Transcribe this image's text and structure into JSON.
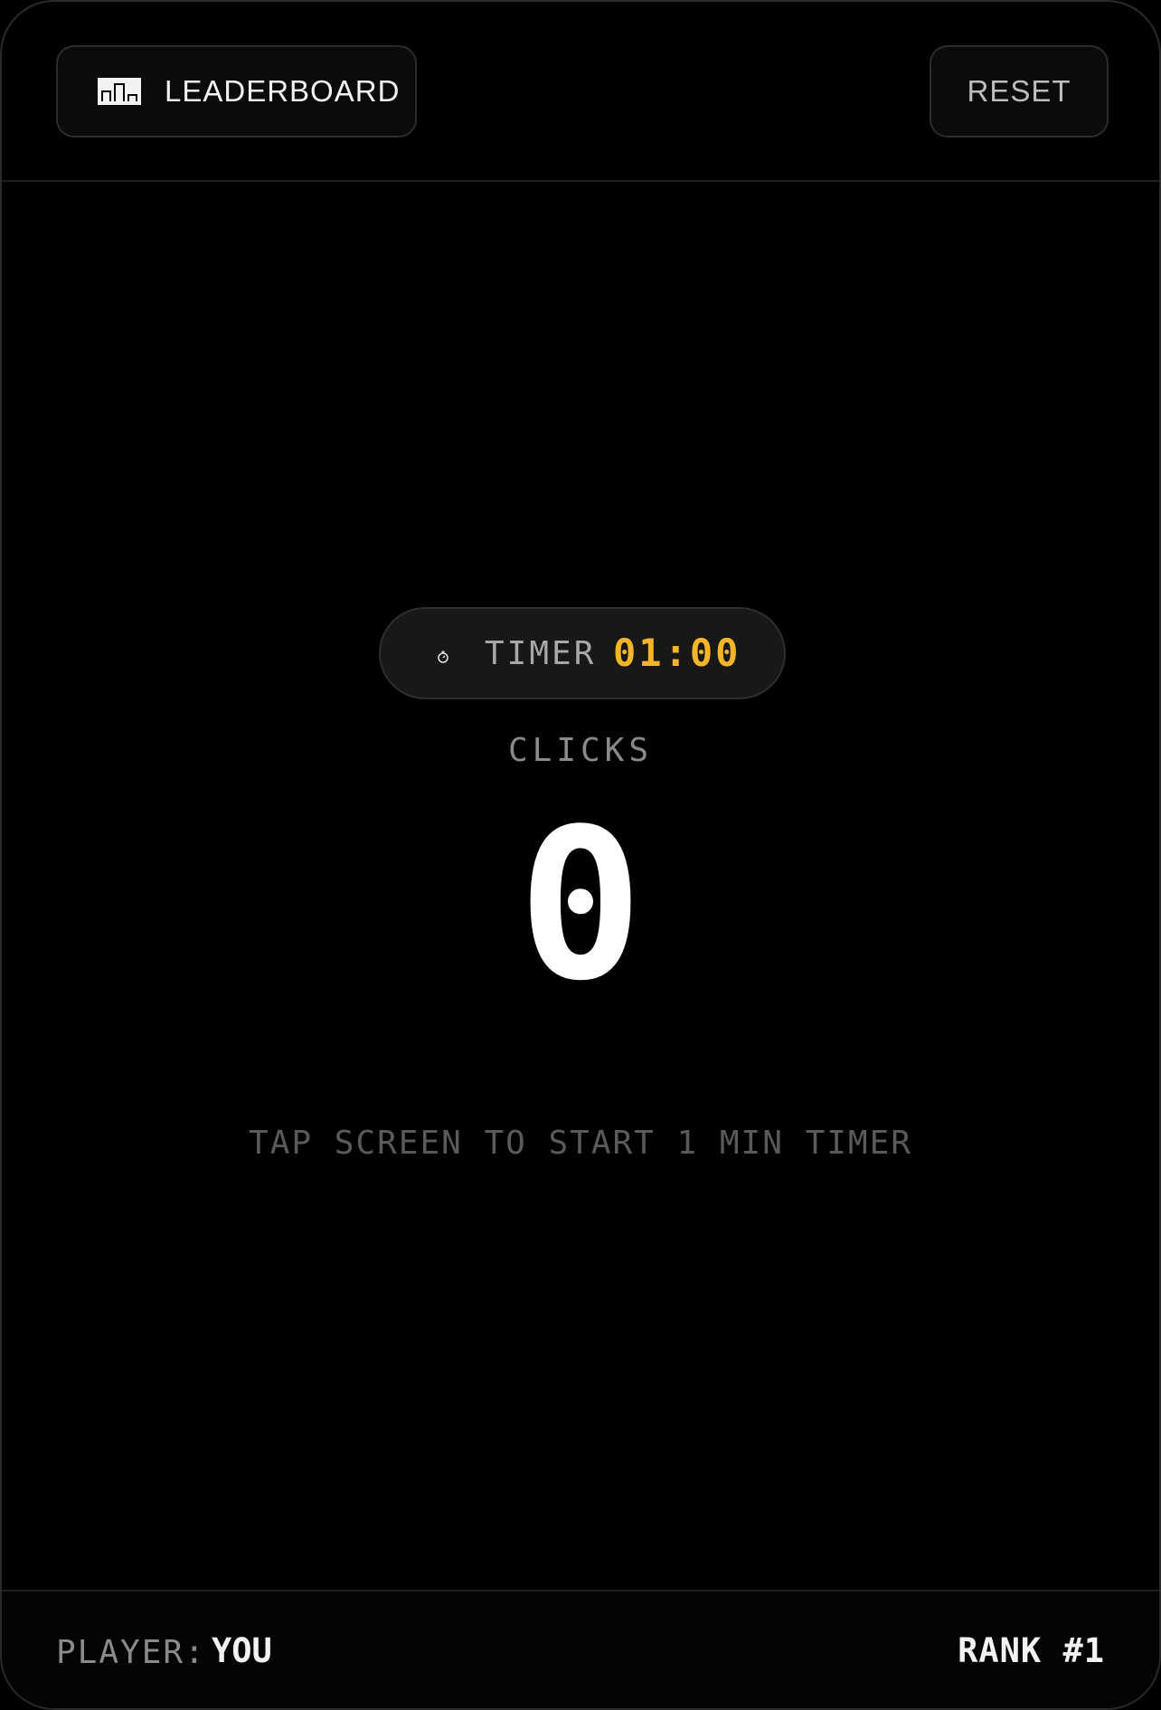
{
  "header": {
    "leaderboard_label": "LEADERBOARD",
    "leaderboard_icon": "podium-icon",
    "reset_label": "RESET"
  },
  "timer": {
    "icon": "stopwatch-icon",
    "label": "TIMER",
    "value": "01:00"
  },
  "counter": {
    "label": "CLICKS",
    "value": "0"
  },
  "hint": "TAP SCREEN TO START 1 MIN TIMER",
  "footer": {
    "player_label": "PLAYER:",
    "player_name": "YOU",
    "rank": "RANK #1"
  },
  "colors": {
    "background": "#000000",
    "accent": "#f5b52a",
    "text_primary": "#ffffff",
    "text_muted": "#8a8a8a"
  }
}
